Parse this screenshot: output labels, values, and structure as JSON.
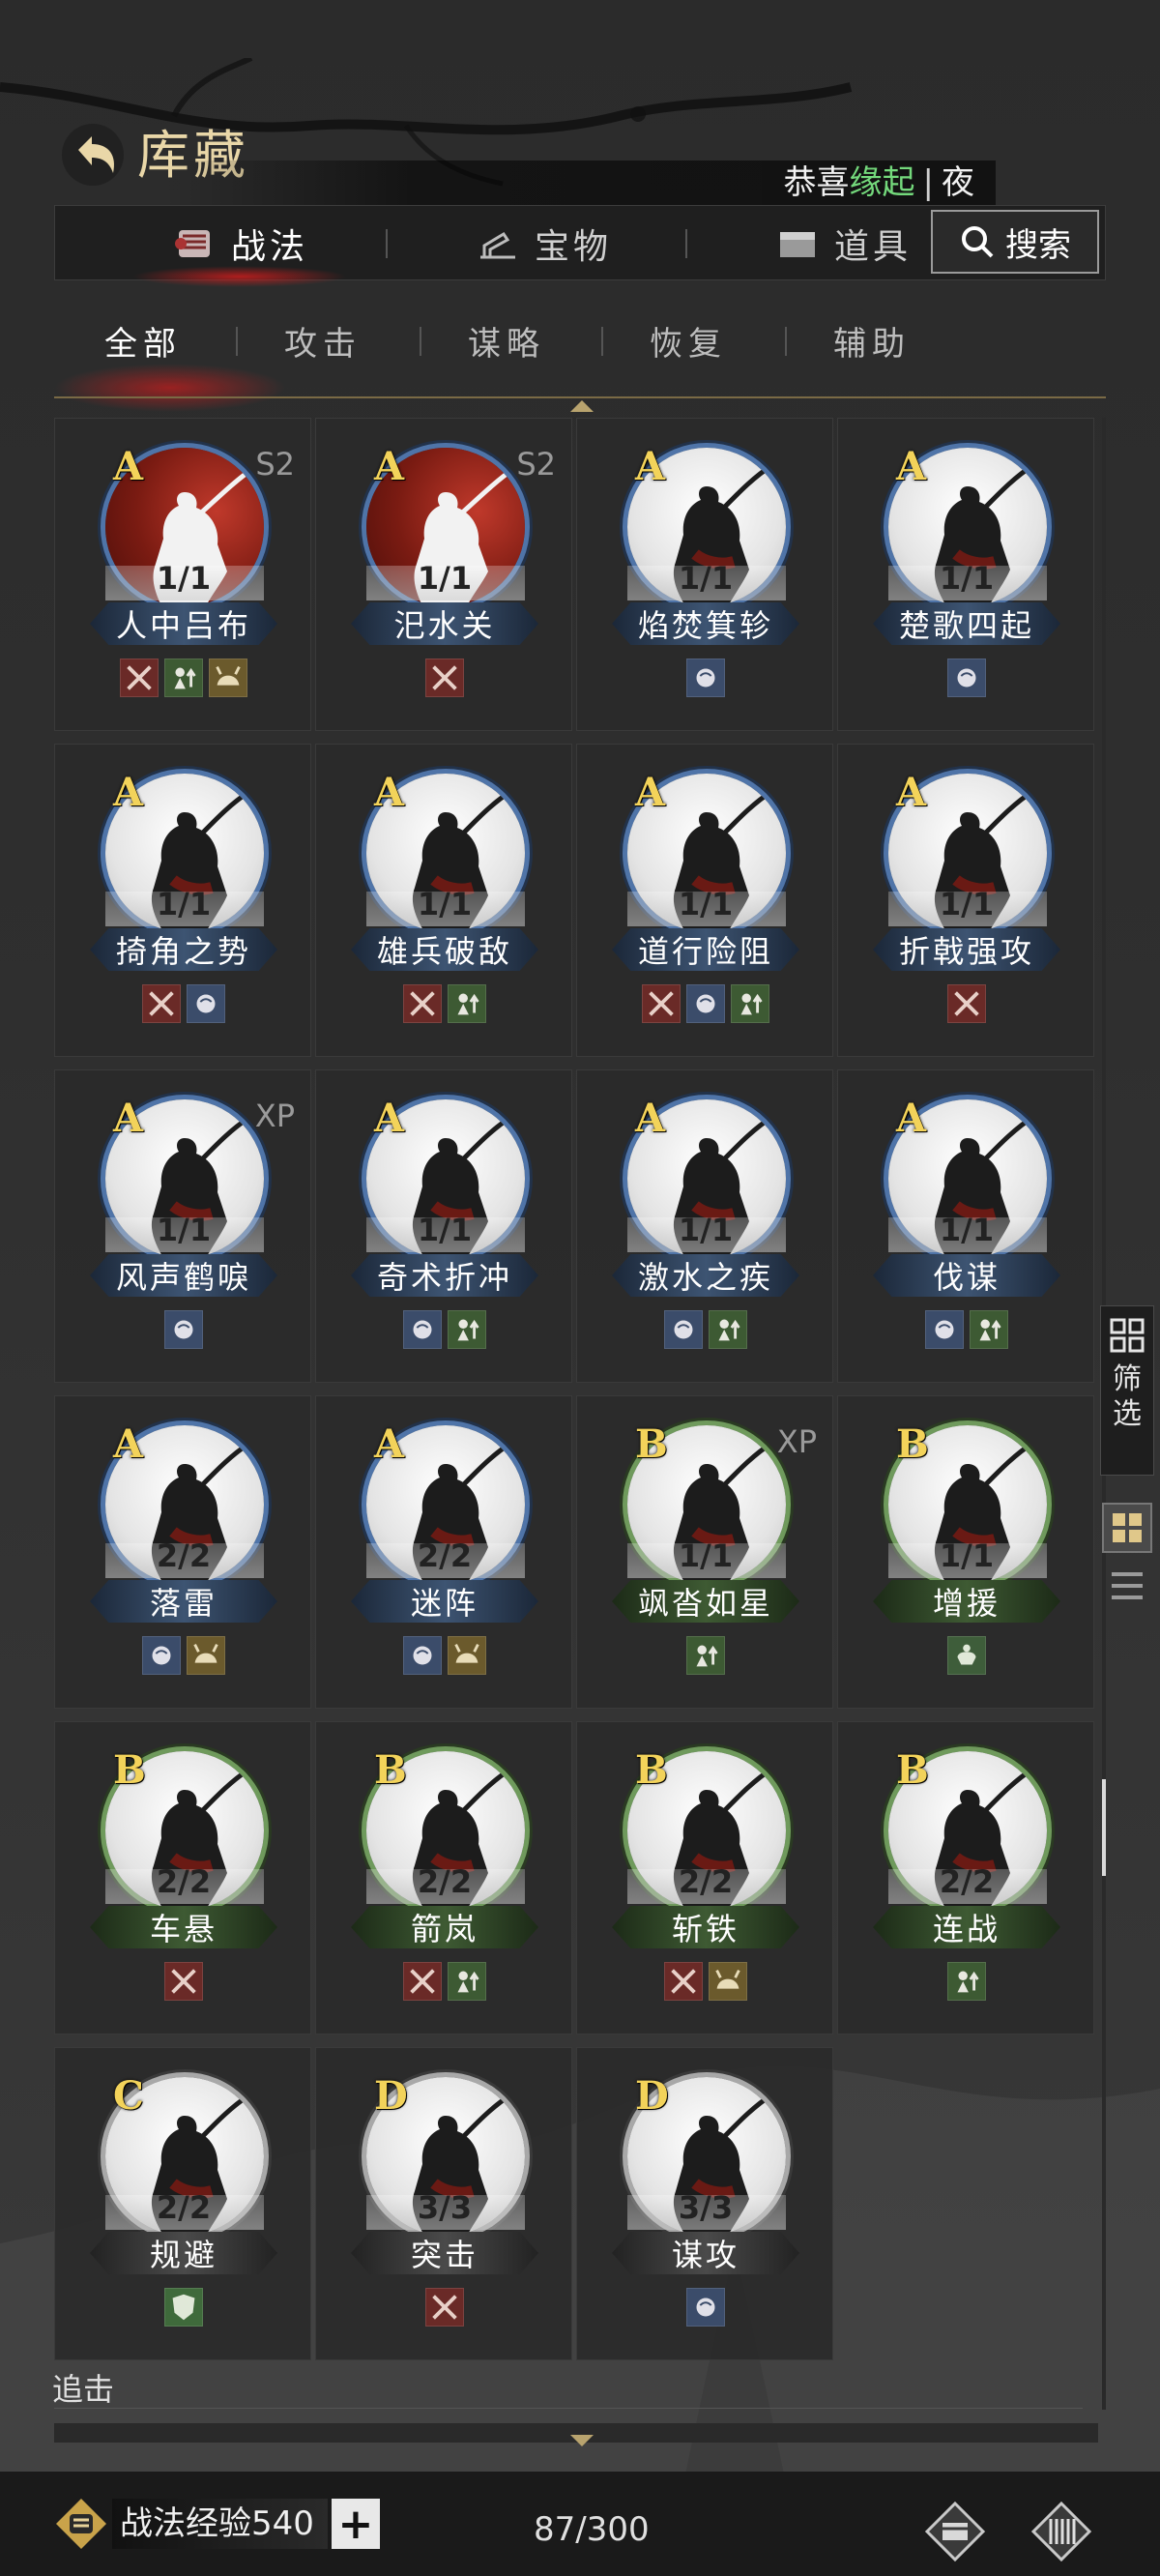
{
  "header": {
    "title": "库藏",
    "notice_prefix": "恭喜",
    "notice_highlight": "缘起",
    "notice_sep": "|",
    "notice_suffix": "夜"
  },
  "tabs": [
    {
      "label": "战法",
      "icon": "scroll-icon",
      "active": true
    },
    {
      "label": "宝物",
      "icon": "cannon-icon",
      "active": false
    },
    {
      "label": "道具",
      "icon": "chest-icon",
      "active": false
    }
  ],
  "search": {
    "label": "搜索",
    "icon": "search-icon"
  },
  "subtabs": [
    "全部",
    "攻击",
    "谋略",
    "恢复",
    "辅助"
  ],
  "colors": {
    "grade_A": "#4f74a8",
    "grade_B": "#6f9a5c",
    "grade_C": "#a8a8a8",
    "grade_text": "#f3d35a",
    "highlight": "#74d97c"
  },
  "cards": [
    {
      "grade": "A",
      "name": "人中吕布",
      "count": "1/1",
      "tag": "S2",
      "art": "red",
      "badges": [
        "attack",
        "boost",
        "control"
      ]
    },
    {
      "grade": "A",
      "name": "汜水关",
      "count": "1/1",
      "tag": "S2",
      "art": "red",
      "badges": [
        "attack"
      ]
    },
    {
      "grade": "A",
      "name": "焰焚箕轸",
      "count": "1/1",
      "tag": "",
      "art": "ink",
      "badges": [
        "strategy"
      ]
    },
    {
      "grade": "A",
      "name": "楚歌四起",
      "count": "1/1",
      "tag": "",
      "art": "ink",
      "badges": [
        "strategy"
      ]
    },
    {
      "grade": "A",
      "name": "掎角之势",
      "count": "1/1",
      "tag": "",
      "art": "ink",
      "badges": [
        "attack",
        "strategy"
      ]
    },
    {
      "grade": "A",
      "name": "雄兵破敌",
      "count": "1/1",
      "tag": "",
      "art": "ink",
      "badges": [
        "attack",
        "boost"
      ]
    },
    {
      "grade": "A",
      "name": "道行险阻",
      "count": "1/1",
      "tag": "",
      "art": "ink",
      "badges": [
        "attack",
        "strategy",
        "boost"
      ]
    },
    {
      "grade": "A",
      "name": "折戟强攻",
      "count": "1/1",
      "tag": "",
      "art": "ink",
      "badges": [
        "attack"
      ]
    },
    {
      "grade": "A",
      "name": "风声鹤唳",
      "count": "1/1",
      "tag": "XP",
      "art": "ink",
      "badges": [
        "strategy"
      ]
    },
    {
      "grade": "A",
      "name": "奇术折冲",
      "count": "1/1",
      "tag": "",
      "art": "ink",
      "badges": [
        "strategy",
        "boost"
      ]
    },
    {
      "grade": "A",
      "name": "激水之疾",
      "count": "1/1",
      "tag": "",
      "art": "ink",
      "badges": [
        "strategy",
        "boost"
      ]
    },
    {
      "grade": "A",
      "name": "伐谋",
      "count": "1/1",
      "tag": "",
      "art": "ink",
      "badges": [
        "strategy",
        "boost"
      ]
    },
    {
      "grade": "A",
      "name": "落雷",
      "count": "2/2",
      "tag": "",
      "art": "ink",
      "badges": [
        "strategy",
        "control"
      ]
    },
    {
      "grade": "A",
      "name": "迷阵",
      "count": "2/2",
      "tag": "",
      "art": "ink",
      "badges": [
        "strategy",
        "control"
      ]
    },
    {
      "grade": "B",
      "name": "飒沓如星",
      "count": "1/1",
      "tag": "XP",
      "art": "ink",
      "badges": [
        "boost"
      ]
    },
    {
      "grade": "B",
      "name": "增援",
      "count": "1/1",
      "tag": "",
      "art": "ink",
      "badges": [
        "heal"
      ]
    },
    {
      "grade": "B",
      "name": "车悬",
      "count": "2/2",
      "tag": "",
      "art": "ink",
      "badges": [
        "attack"
      ]
    },
    {
      "grade": "B",
      "name": "箭岚",
      "count": "2/2",
      "tag": "",
      "art": "ink",
      "badges": [
        "attack",
        "boost"
      ]
    },
    {
      "grade": "B",
      "name": "斩铁",
      "count": "2/2",
      "tag": "",
      "art": "ink",
      "badges": [
        "attack",
        "control"
      ]
    },
    {
      "grade": "B",
      "name": "连战",
      "count": "2/2",
      "tag": "",
      "art": "ink",
      "badges": [
        "boost"
      ]
    },
    {
      "grade": "C",
      "name": "规避",
      "count": "2/2",
      "tag": "",
      "art": "ink",
      "badges": [
        "shield"
      ]
    },
    {
      "grade": "D",
      "name": "突击",
      "count": "3/3",
      "tag": "",
      "art": "ink",
      "badges": [
        "attack"
      ]
    },
    {
      "grade": "D",
      "name": "谋攻",
      "count": "3/3",
      "tag": "",
      "art": "ink",
      "badges": [
        "strategy"
      ]
    }
  ],
  "side": {
    "filter_label_1": "筛",
    "filter_label_2": "选"
  },
  "section": {
    "label": "追击"
  },
  "footer": {
    "exp_label": "战法经验540",
    "add_label": "+",
    "capacity": "87/300"
  }
}
